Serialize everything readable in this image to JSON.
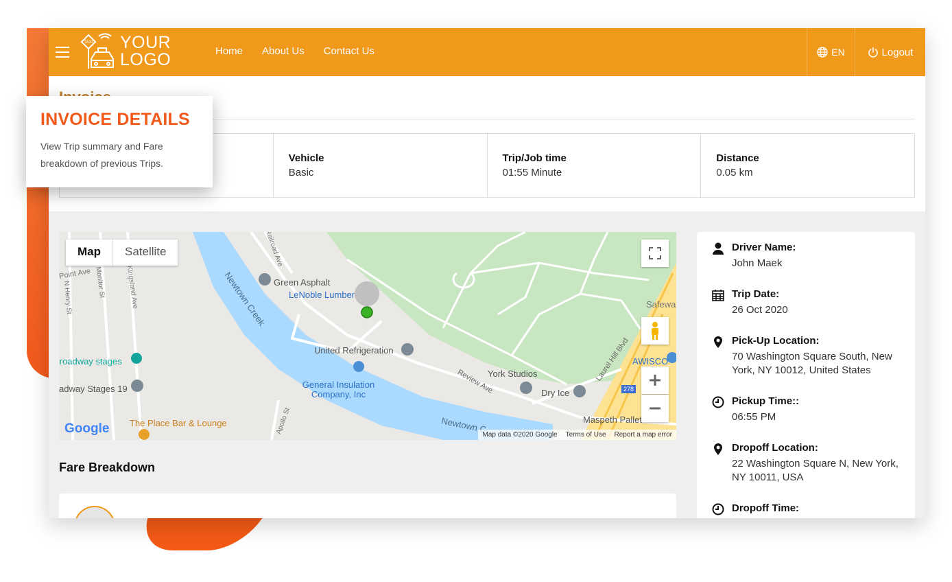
{
  "brand": {
    "logo_line1": "YOUR",
    "logo_line2": "LOGO",
    "logo_sign": "TAXI"
  },
  "nav": {
    "items": [
      "Home",
      "About Us",
      "Contact Us"
    ]
  },
  "header": {
    "lang": "EN",
    "logout": "Logout"
  },
  "page": {
    "title": "Invoice"
  },
  "stats": [
    {
      "label": "",
      "value": ""
    },
    {
      "label": "Vehicle",
      "value": "Basic"
    },
    {
      "label": "Trip/Job time",
      "value": "01:55 Minute"
    },
    {
      "label": "Distance",
      "value": "0.05 km"
    }
  ],
  "map": {
    "type_map": "Map",
    "type_satellite": "Satellite",
    "attribution": "Map data ©2020 Google",
    "terms": "Terms of Use",
    "report": "Report a map error",
    "google": "Google",
    "labels": {
      "newtown_creek": "Newtown Creek",
      "newtown_creek2": "Newtown C",
      "green_asphalt": "Green Asphalt",
      "lenoble": "LeNoble Lumber",
      "united_ref": "United Refrigeration",
      "broadway": "Broadway stages",
      "broadway19": "adway Stages 19",
      "general_ins": "General Insulation Company, Inc",
      "place_bar": "The Place Bar & Lounge",
      "york": "York Studios",
      "dry_ice": "Dry Ice",
      "review": "Review Ave",
      "laurel": "Laurel Hill Blvd",
      "awisco": "AWISCO",
      "safeway": "Safewa",
      "maspeth": "Maspeth Pallet",
      "railroad": "Railroad Ave",
      "kingsland": "Kingsland Ave",
      "monitor": "Monitor St",
      "henry": "N Henry St",
      "point": "Point Ave",
      "apollo": "Apollo St",
      "hwy": "278"
    }
  },
  "fare": {
    "title": "Fare Breakdown"
  },
  "details": {
    "driver_label": "Driver Name:",
    "driver": "John Maek",
    "date_label": "Trip Date:",
    "date": "26 Oct 2020",
    "pickup_label": "Pick-Up Location:",
    "pickup": "70 Washington Square South, New York, NY 10012, United States",
    "pickup_time_label": "Pickup Time::",
    "pickup_time": "06:55 PM",
    "dropoff_label": "Dropoff Location:",
    "dropoff": "22 Washington Square N, New York, NY 10011, USA",
    "dropoff_time_label": "Dropoff Time:"
  },
  "popover": {
    "title": "INVOICE DETAILS",
    "desc": "View Trip summary and Fare breakdown of previous Trips."
  },
  "colors": {
    "accent": "#f0991b",
    "brand_red": "#f25a1c",
    "water": "#aadaff",
    "park": "#c8e6c1"
  }
}
